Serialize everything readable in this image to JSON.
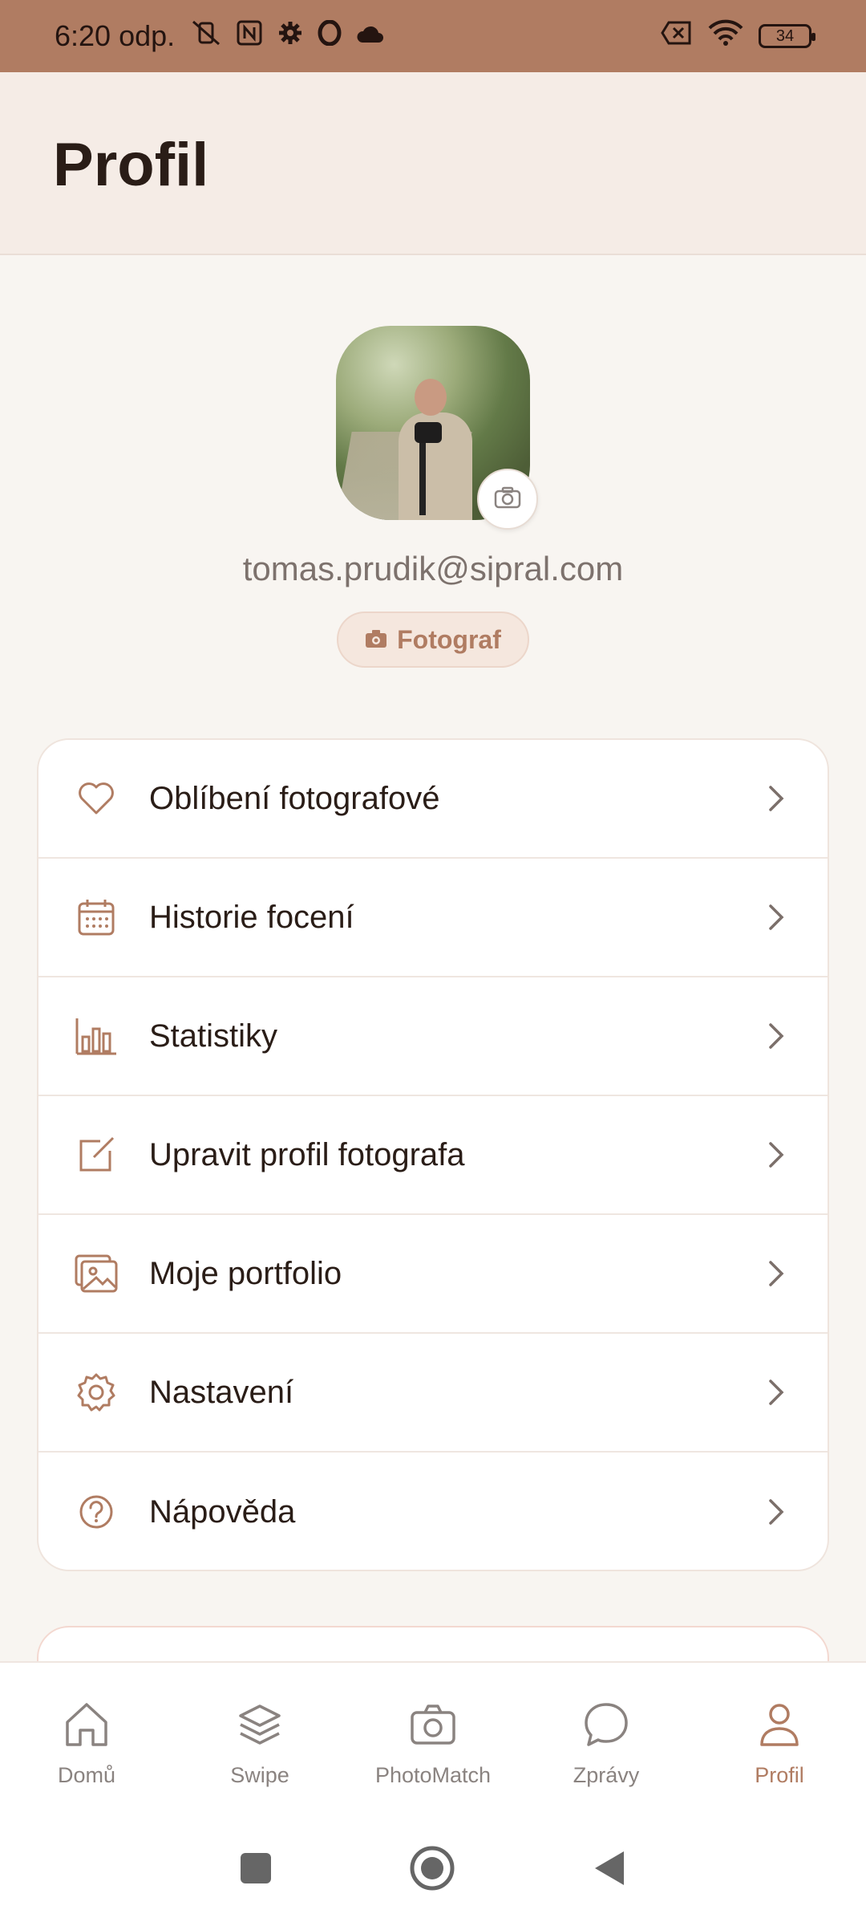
{
  "status_bar": {
    "time": "6:20 odp.",
    "battery": "34"
  },
  "header": {
    "title": "Profil"
  },
  "profile": {
    "email": "tomas.prudik@sipral.com",
    "role": "Fotograf"
  },
  "menu": {
    "items": [
      {
        "label": "Oblíbení fotografové",
        "icon": "heart-icon"
      },
      {
        "label": "Historie focení",
        "icon": "calendar-icon"
      },
      {
        "label": "Statistiky",
        "icon": "bar-chart-icon"
      },
      {
        "label": "Upravit profil fotografa",
        "icon": "edit-icon"
      },
      {
        "label": "Moje portfolio",
        "icon": "gallery-icon"
      },
      {
        "label": "Nastavení",
        "icon": "gear-icon"
      },
      {
        "label": "Nápověda",
        "icon": "help-icon"
      }
    ]
  },
  "bottom_nav": {
    "items": [
      {
        "label": "Domů",
        "icon": "home-icon"
      },
      {
        "label": "Swipe",
        "icon": "layers-icon"
      },
      {
        "label": "PhotoMatch",
        "icon": "camera-icon"
      },
      {
        "label": "Zprávy",
        "icon": "chat-icon"
      },
      {
        "label": "Profil",
        "icon": "user-icon",
        "active": true
      }
    ]
  },
  "colors": {
    "accent": "#b07c62",
    "status_bar": "#b07c62",
    "header_bg": "#f5ece6",
    "page_bg": "#f8f5f1"
  }
}
